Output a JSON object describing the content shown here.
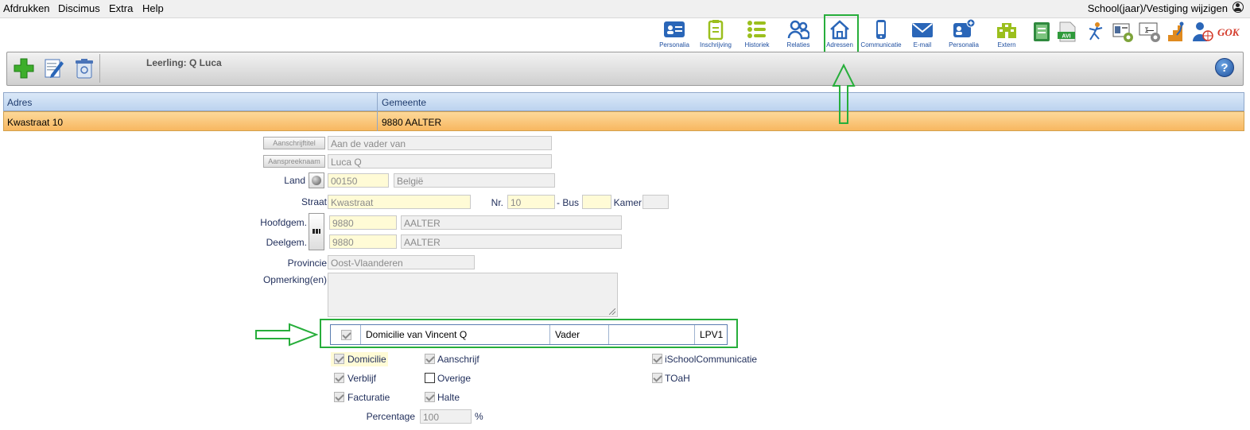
{
  "menu": [
    "Afdrukken",
    "Discimus",
    "Extra",
    "Help"
  ],
  "school_link": "School(jaar)/Vestiging wijzigen",
  "toolbar": [
    {
      "label": "Personalia",
      "icon": "id-card-icon"
    },
    {
      "label": "Inschrijving",
      "icon": "clipboard-icon"
    },
    {
      "label": "Historiek",
      "icon": "list-icon"
    },
    {
      "label": "Relaties",
      "icon": "people-icon"
    },
    {
      "label": "Adressen",
      "icon": "home-icon"
    },
    {
      "label": "Communicatie",
      "icon": "phone-icon"
    },
    {
      "label": "E-mail",
      "icon": "envelope-icon"
    },
    {
      "label": "Personalia",
      "icon": "id-card-plus-icon"
    },
    {
      "label": "Extern",
      "icon": "school-building-icon"
    }
  ],
  "panel": {
    "title": "Leerling: Q Luca",
    "help": "?"
  },
  "grid": {
    "columns": [
      "Adres",
      "Gemeente"
    ],
    "rows": [
      [
        "Kwastraat 10",
        "9880 AALTER"
      ]
    ]
  },
  "form": {
    "aanschrijftitel_btn": "Aanschrijftitel",
    "aanschrijftitel": "Aan de vader van",
    "aanspreeknaam_btn": "Aanspreeknaam",
    "aanspreeknaam": "Luca Q",
    "land_label": "Land",
    "land_code": "00150",
    "land_name": "België",
    "straat_label": "Straat",
    "straat": "Kwastraat",
    "nr_label": "Nr.",
    "nr": "10",
    "bus_label": "- Bus",
    "bus": "",
    "kamer_label": "Kamer",
    "kamer": "",
    "hoofdgem_label": "Hoofdgem.",
    "hoofdgem_code": "9880",
    "hoofdgem_name": "AALTER",
    "deelgem_label": "Deelgem.",
    "deelgem_code": "9880",
    "deelgem_name": "AALTER",
    "provincie_label": "Provincie",
    "provincie": "Oost-Vlaanderen",
    "opmerking_label": "Opmerking(en)"
  },
  "domicilie_row": {
    "name": "Domicilie van Vincent Q",
    "relation": "Vader",
    "extra": "",
    "code": "LPV1"
  },
  "checkboxes": {
    "domicilie": "Domicilie",
    "aanschrijf": "Aanschrijf",
    "ischool": "iSchoolCommunicatie",
    "verblijf": "Verblijf",
    "overige": "Overige",
    "toah": "TOaH",
    "facturatie": "Facturatie",
    "halte": "Halte"
  },
  "percentage": {
    "label": "Percentage",
    "value": "100",
    "unit": "%"
  },
  "colors": {
    "highlight": "#27ae3b",
    "row_selected": "#f8b760",
    "accent": "#1f4fa0"
  }
}
